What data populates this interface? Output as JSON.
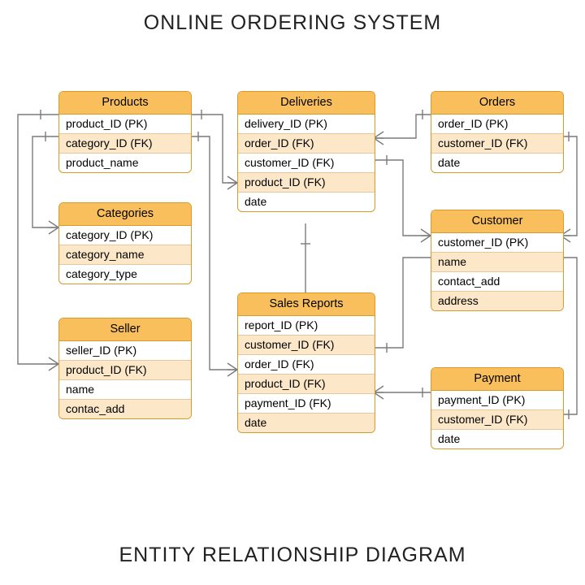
{
  "title": "ONLINE ORDERING SYSTEM",
  "subtitle": "ENTITY RELATIONSHIP DIAGRAM",
  "entities": {
    "products": {
      "name": "Products",
      "fields": [
        "product_ID (PK)",
        "category_ID (FK)",
        "product_name"
      ]
    },
    "categories": {
      "name": "Categories",
      "fields": [
        "category_ID (PK)",
        "category_name",
        "category_type"
      ]
    },
    "seller": {
      "name": "Seller",
      "fields": [
        "seller_ID (PK)",
        "product_ID (FK)",
        "name",
        "contac_add"
      ]
    },
    "deliveries": {
      "name": "Deliveries",
      "fields": [
        "delivery_ID (PK)",
        "order_ID (FK)",
        "customer_ID (FK)",
        "product_ID (FK)",
        "date"
      ]
    },
    "salesreports": {
      "name": "Sales Reports",
      "fields": [
        "report_ID (PK)",
        "customer_ID (FK)",
        "order_ID (FK)",
        "product_ID (FK)",
        "payment_ID (FK)",
        "date"
      ]
    },
    "orders": {
      "name": "Orders",
      "fields": [
        "order_ID (PK)",
        "customer_ID (FK)",
        "date"
      ]
    },
    "customer": {
      "name": "Customer",
      "fields": [
        "customer_ID (PK)",
        "name",
        "contact_add",
        "address"
      ]
    },
    "payment": {
      "name": "Payment",
      "fields": [
        "payment_ID (PK)",
        "customer_ID (FK)",
        "date"
      ]
    }
  },
  "relationships": [
    {
      "from": "products.product_ID",
      "to": "deliveries.product_ID",
      "type": "one-to-many"
    },
    {
      "from": "products.category_ID",
      "to": "categories.category_ID",
      "type": "many-to-one"
    },
    {
      "from": "products.product_ID",
      "to": "seller.product_ID",
      "type": "one-to-many"
    },
    {
      "from": "products.product_ID",
      "to": "salesreports.product_ID",
      "type": "one-to-many"
    },
    {
      "from": "deliveries.order_ID",
      "to": "orders.order_ID",
      "type": "many-to-one"
    },
    {
      "from": "deliveries.customer_ID",
      "to": "customer.customer_ID",
      "type": "many-to-one"
    },
    {
      "from": "orders.customer_ID",
      "to": "customer.customer_ID",
      "type": "many-to-one"
    },
    {
      "from": "salesreports.customer_ID",
      "to": "customer.customer_ID",
      "type": "many-to-one"
    },
    {
      "from": "salesreports.payment_ID",
      "to": "payment.payment_ID",
      "type": "many-to-one"
    },
    {
      "from": "payment.customer_ID",
      "to": "customer.customer_ID",
      "type": "many-to-one"
    }
  ]
}
